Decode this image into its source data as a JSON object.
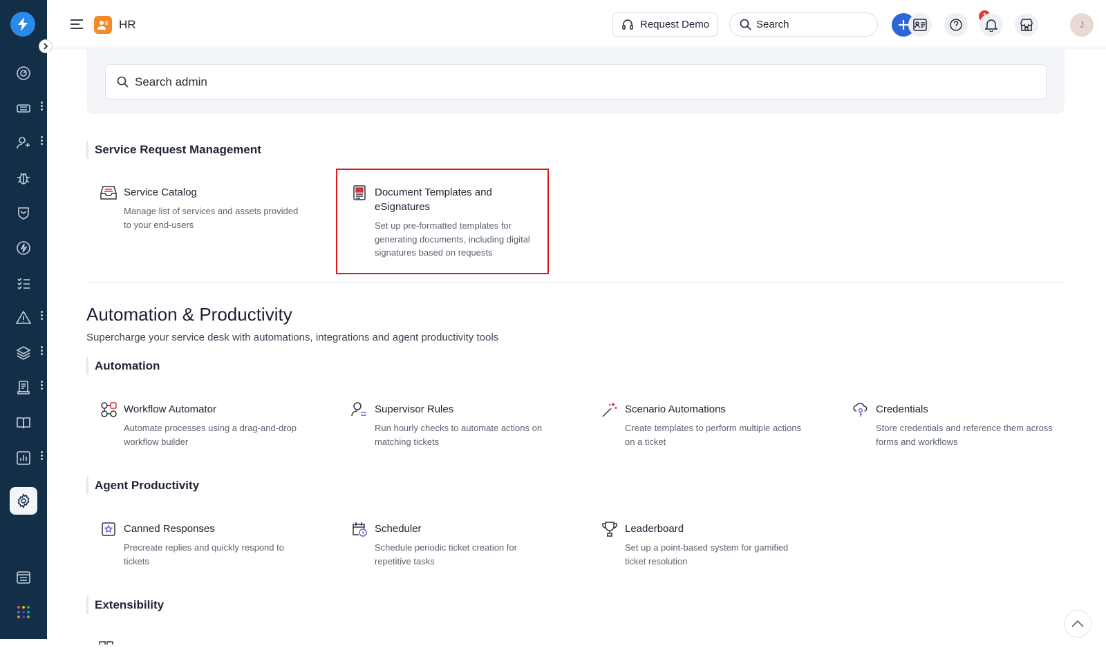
{
  "workspace": {
    "name": "HR"
  },
  "topbar": {
    "request_demo_label": "Request Demo",
    "search_label": "Search",
    "help_badge_count": "1",
    "avatar_initial": "J"
  },
  "admin_search": {
    "placeholder": "Search admin"
  },
  "service_request_management": {
    "heading": "Service Request Management",
    "cards": [
      {
        "title": "Service Catalog",
        "desc": "Manage list of services and assets provided to your end-users",
        "icon": "inbox-tray-icon"
      },
      {
        "title": "Document Templates and eSignatures",
        "desc": "Set up pre-formatted templates for generating documents, including digital signatures based on requests",
        "icon": "document-template-icon"
      }
    ]
  },
  "automation_productivity": {
    "title": "Automation & Productivity",
    "subtitle": "Supercharge your service desk with automations, integrations and agent productivity tools"
  },
  "automation": {
    "heading": "Automation",
    "cards": [
      {
        "title": "Workflow Automator",
        "desc": "Automate processes using a drag-and-drop workflow builder",
        "icon": "workflow-icon"
      },
      {
        "title": "Supervisor Rules",
        "desc": "Run hourly checks to automate actions on matching tickets",
        "icon": "supervisor-icon"
      },
      {
        "title": "Scenario Automations",
        "desc": "Create templates to perform multiple actions on a ticket",
        "icon": "magic-wand-icon"
      },
      {
        "title": "Credentials",
        "desc": "Store credentials and reference them across forms and workflows",
        "icon": "cloud-key-icon"
      }
    ]
  },
  "agent_productivity": {
    "heading": "Agent Productivity",
    "cards": [
      {
        "title": "Canned Responses",
        "desc": "Precreate replies and quickly respond to tickets",
        "icon": "canned-response-icon"
      },
      {
        "title": "Scheduler",
        "desc": "Schedule periodic ticket creation for repetitive tasks",
        "icon": "calendar-clock-icon"
      },
      {
        "title": "Leaderboard",
        "desc": "Set up a point-based system for gamified ticket resolution",
        "icon": "trophy-icon"
      }
    ]
  },
  "extensibility": {
    "heading": "Extensibility"
  },
  "colors": {
    "sidebar_bg": "#132e47",
    "accent_blue": "#2e66d7",
    "workspace_orange": "#f08a2b",
    "highlight_red": "#e0161d",
    "badge_red": "#e53935"
  }
}
